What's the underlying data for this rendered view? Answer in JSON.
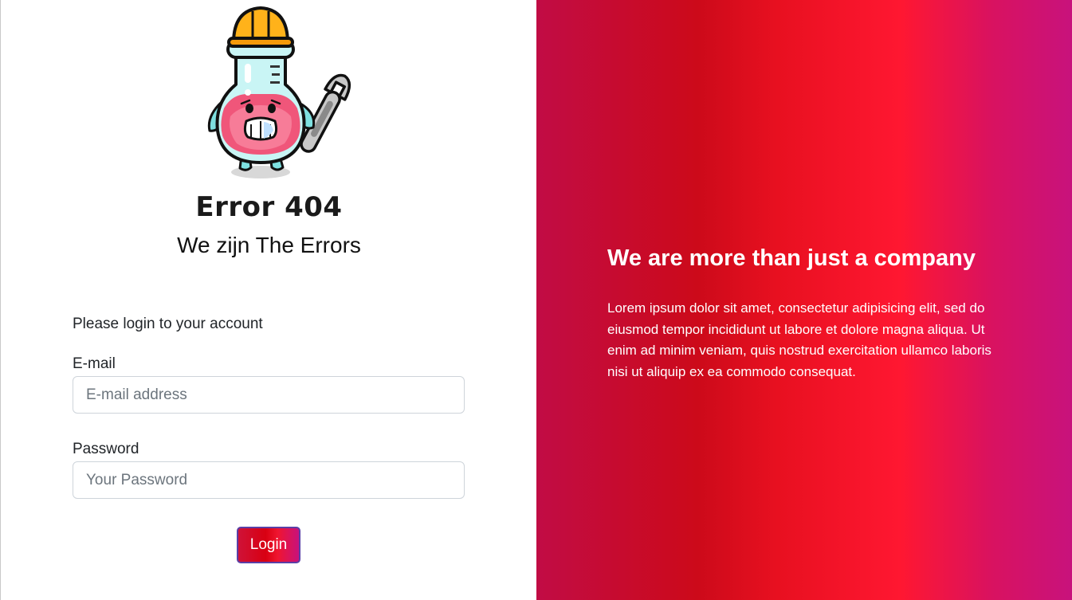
{
  "brand": {
    "title": "Error 404",
    "subtitle": "We zijn The Errors",
    "mascot_icon": "lab-flask-mascot-icon"
  },
  "login": {
    "prompt": "Please login to your account",
    "email_label": "E-mail",
    "email_placeholder": "E-mail address",
    "email_value": "",
    "password_label": "Password",
    "password_placeholder": "Your Password",
    "password_value": "",
    "button_label": "Login"
  },
  "promo": {
    "title": "We are more than just a company",
    "text": "Lorem ipsum dolor sit amet, consectetur adipisicing elit, sed do eiusmod tempor incididunt ut labore et dolore magna aliqua. Ut enim ad minim veniam, quis nostrud exercitation ullamco laboris nisi ut aliquip ex ea commodo consequat."
  },
  "colors": {
    "accent_red": "#ff1731",
    "accent_magenta": "#c8127c",
    "button_border": "#5a3fa6"
  }
}
